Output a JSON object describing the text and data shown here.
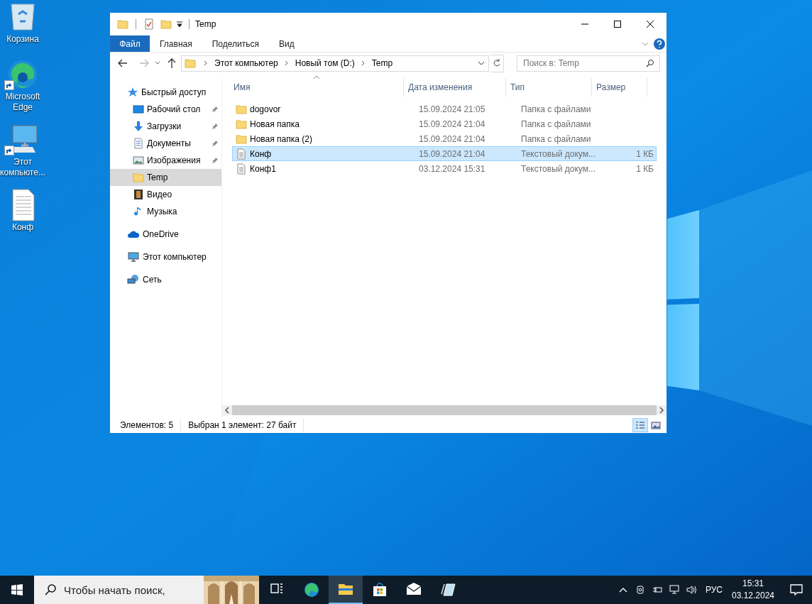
{
  "desktop": {
    "icons": [
      {
        "kind": "recycle",
        "label": "Корзина",
        "shortcut": false
      },
      {
        "kind": "edge",
        "label": "Microsoft Edge",
        "shortcut": true
      },
      {
        "kind": "computer",
        "label": "Этот компьюте...",
        "shortcut": true
      },
      {
        "kind": "textfile",
        "label": "Конф",
        "shortcut": false
      }
    ]
  },
  "window": {
    "title": "Temp",
    "ribbon_tabs": [
      {
        "kind": "file",
        "label": "Файл"
      },
      {
        "kind": "tab",
        "label": "Главная"
      },
      {
        "kind": "tab",
        "label": "Поделиться"
      },
      {
        "kind": "tab",
        "label": "Вид"
      }
    ],
    "address": {
      "path": [
        "Этот компьютер",
        "Новый том (D:)",
        "Temp"
      ]
    },
    "search": {
      "placeholder": "Поиск в: Temp"
    },
    "sidebar": {
      "items": [
        {
          "kind": "star",
          "label": "Быстрый доступ",
          "selected": false,
          "children": [
            {
              "kind": "desktop",
              "label": "Рабочий стол",
              "pinned": true,
              "selected": false
            },
            {
              "kind": "download",
              "label": "Загрузки",
              "pinned": true,
              "selected": false
            },
            {
              "kind": "documents",
              "label": "Документы",
              "pinned": true,
              "selected": false
            },
            {
              "kind": "pictures",
              "label": "Изображения",
              "pinned": true,
              "selected": false
            },
            {
              "kind": "folder",
              "label": "Temp",
              "pinned": false,
              "selected": true
            },
            {
              "kind": "video",
              "label": "Видео",
              "pinned": false,
              "selected": false
            },
            {
              "kind": "music",
              "label": "Музыка",
              "pinned": false,
              "selected": false
            }
          ]
        },
        {
          "kind": "cloud",
          "label": "OneDrive",
          "selected": false
        },
        {
          "kind": "computer",
          "label": "Этот компьютер",
          "selected": false
        },
        {
          "kind": "network",
          "label": "Сеть",
          "selected": false
        }
      ]
    },
    "table": {
      "columns": [
        {
          "label": "Имя",
          "sorted": true
        },
        {
          "label": "Дата изменения",
          "sorted": false
        },
        {
          "label": "Тип",
          "sorted": false
        },
        {
          "label": "Размер",
          "sorted": false
        }
      ],
      "rows": [
        {
          "kind": "folder",
          "name": "dogovor",
          "date": "15.09.2024 21:05",
          "type": "Папка с файлами",
          "selected": false
        },
        {
          "kind": "folder",
          "name": "Новая папка",
          "date": "15.09.2024 21:04",
          "type": "Папка с файлами",
          "selected": false
        },
        {
          "kind": "folder",
          "name": "Новая папка (2)",
          "date": "15.09.2024 21:04",
          "type": "Папка с файлами",
          "selected": false
        },
        {
          "kind": "text",
          "name": "Конф",
          "date": "15.09.2024 21:04",
          "type": "Текстовый докум...",
          "size": "1 КБ",
          "selected": true
        },
        {
          "kind": "text",
          "name": "Конф1",
          "date": "03.12.2024 15:31",
          "type": "Текстовый докум...",
          "size": "1 КБ",
          "selected": false
        }
      ]
    },
    "status_bar": {
      "items": [
        "Элементов: 5",
        "Выбран 1 элемент: 27 байт"
      ],
      "views": [
        {
          "kind": "details",
          "selected": true
        },
        {
          "kind": "tiles",
          "selected": false
        }
      ]
    }
  },
  "taskbar": {
    "search": {
      "placeholder": "Чтобы начать поиск,"
    },
    "apps": [
      {
        "kind": "taskview",
        "active": false
      },
      {
        "kind": "edge",
        "active": false
      },
      {
        "kind": "explorer",
        "active": true
      },
      {
        "kind": "store",
        "active": false
      },
      {
        "kind": "mail",
        "active": false
      },
      {
        "kind": "notes",
        "active": false
      }
    ],
    "language": "РУС",
    "time": "15:31",
    "date": "03.12.2024"
  }
}
